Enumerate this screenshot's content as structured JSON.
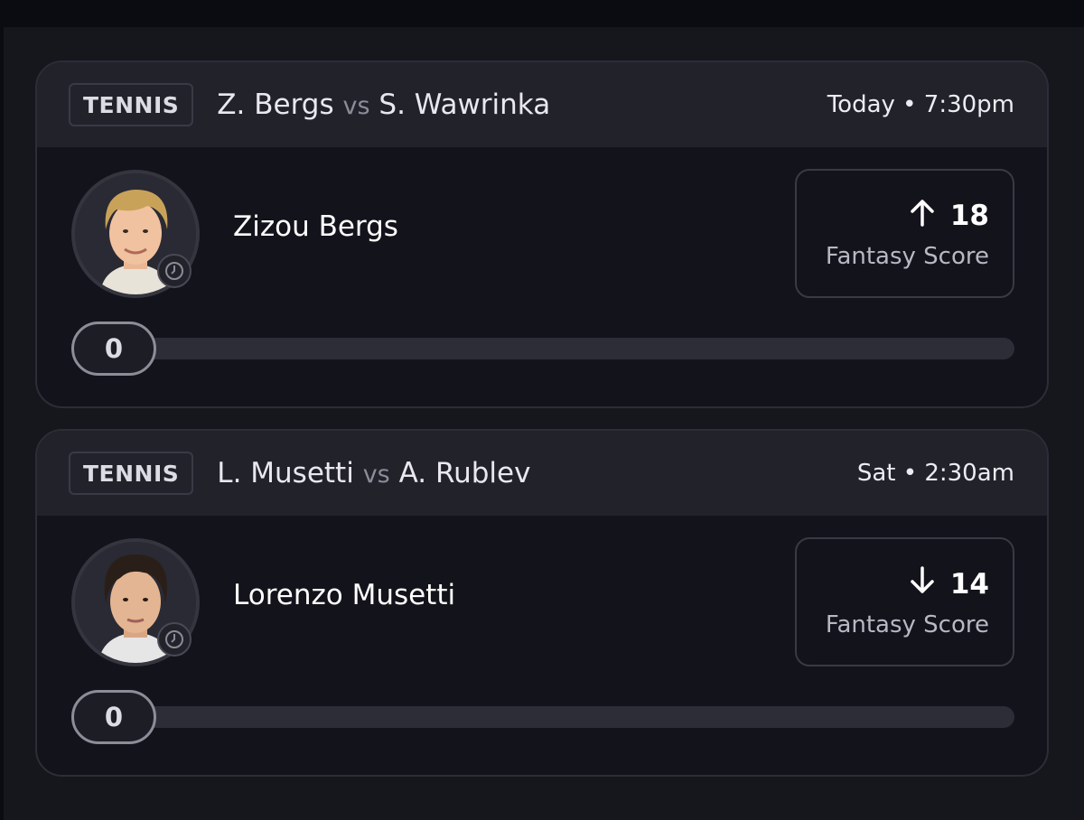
{
  "cards": [
    {
      "sport": "TENNIS",
      "player_a": "Z. Bergs",
      "vs": "vs",
      "player_b": "S. Wawrinka",
      "time": "Today • 7:30pm",
      "player_name": "Zizou Bergs",
      "direction_icon": "arrow-up-icon",
      "score": "18",
      "score_label": "Fantasy Score",
      "progress_value": "0",
      "progress_fraction": 0,
      "avatar_hair": "#c9a25a"
    },
    {
      "sport": "TENNIS",
      "player_a": "L. Musetti",
      "vs": "vs",
      "player_b": "A. Rublev",
      "time": "Sat • 2:30am",
      "player_name": "Lorenzo Musetti",
      "direction_icon": "arrow-down-icon",
      "score": "14",
      "score_label": "Fantasy Score",
      "progress_value": "0",
      "progress_fraction": 0,
      "avatar_hair": "#2a1f18"
    }
  ]
}
